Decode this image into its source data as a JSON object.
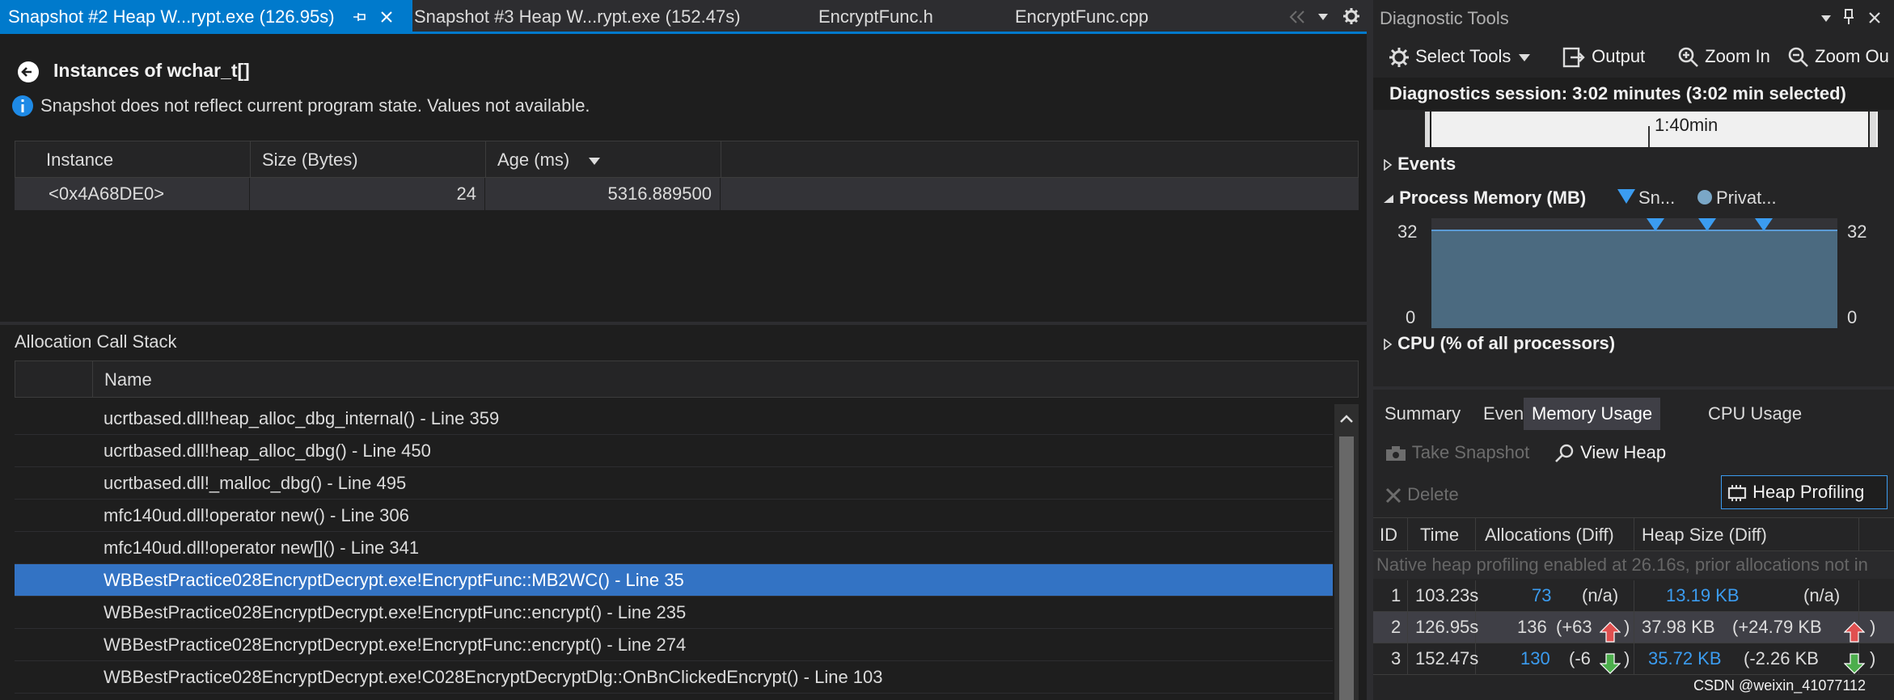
{
  "tabs": [
    {
      "label": "Snapshot #2 Heap W...rypt.exe (126.95s)",
      "active": true
    },
    {
      "label": "Snapshot #3 Heap W...rypt.exe (152.47s)",
      "active": false
    },
    {
      "label": "EncryptFunc.h",
      "active": false
    },
    {
      "label": "EncryptFunc.cpp",
      "active": false
    }
  ],
  "instances": {
    "title": "Instances of wchar_t[]",
    "notice": "Snapshot does not reflect current program state. Values not available.",
    "columns": [
      "Instance",
      "Size (Bytes)",
      "Age (ms)"
    ],
    "rows": [
      {
        "instance": "<0x4A68DE0>",
        "size": "24",
        "age": "5316.889500"
      }
    ]
  },
  "callstack": {
    "title": "Allocation Call Stack",
    "column": "Name",
    "selected_index": 5,
    "frames": [
      "ucrtbased.dll!heap_alloc_dbg_internal() - Line 359",
      "ucrtbased.dll!heap_alloc_dbg() - Line 450",
      "ucrtbased.dll!_malloc_dbg() - Line 495",
      "mfc140ud.dll!operator new() - Line 306",
      "mfc140ud.dll!operator new[]() - Line 341",
      "WBBestPractice028EncryptDecrypt.exe!EncryptFunc::MB2WC() - Line 35",
      "WBBestPractice028EncryptDecrypt.exe!EncryptFunc::encrypt() - Line 235",
      "WBBestPractice028EncryptDecrypt.exe!EncryptFunc::encrypt() - Line 274",
      "WBBestPractice028EncryptDecrypt.exe!C028EncryptDecryptDlg::OnBnClickedEncrypt() - Line 103"
    ]
  },
  "diag": {
    "title": "Diagnostic Tools",
    "toolbar": {
      "select_tools": "Select Tools",
      "output": "Output",
      "zoom_in": "Zoom In",
      "zoom_out": "Zoom Ou"
    },
    "session": "Diagnostics session: 3:02 minutes (3:02 min selected)",
    "timeline_label": "1:40min",
    "events_label": "Events",
    "memory": {
      "title": "Process Memory (MB)",
      "legend_snapshot": "Sn...",
      "legend_private": "Privat...",
      "y_max": "32",
      "y_min": "0"
    },
    "cpu_label": "CPU (% of all processors)",
    "bottom_tabs": [
      "Summary",
      "Events",
      "Memory Usage",
      "CPU Usage"
    ],
    "active_bottom_tab": "Memory Usage",
    "actions": {
      "take_snapshot": "Take Snapshot",
      "view_heap": "View Heap",
      "delete": "Delete",
      "heap_profiling": "Heap Profiling"
    },
    "table": {
      "columns": [
        "ID",
        "Time",
        "Allocations (Diff)",
        "Heap Size (Diff)"
      ],
      "notice": "Native heap profiling enabled at 26.16s, prior allocations not in",
      "rows": [
        {
          "id": "1",
          "time": "103.23s",
          "alloc": "73",
          "alloc_diff": "(n/a)",
          "heap": "13.19 KB",
          "heap_diff": "(n/a)"
        },
        {
          "id": "2",
          "time": "126.95s",
          "alloc": "136",
          "alloc_diff": "(+63",
          "heap": "37.98 KB",
          "heap_diff": "(+24.79 KB"
        },
        {
          "id": "3",
          "time": "152.47s",
          "alloc": "130",
          "alloc_diff": "(-6",
          "heap": "35.72 KB",
          "heap_diff": "(-2.26 KB"
        }
      ]
    }
  },
  "watermark": "CSDN @weixin_41077112",
  "colors": {
    "accent": "#007acc",
    "selected_row": "#3373c4",
    "chart_fill": "#4b6a80",
    "chart_line": "#3b9cf0",
    "arrow_up": "#e05050",
    "arrow_down": "#4cae4c"
  }
}
